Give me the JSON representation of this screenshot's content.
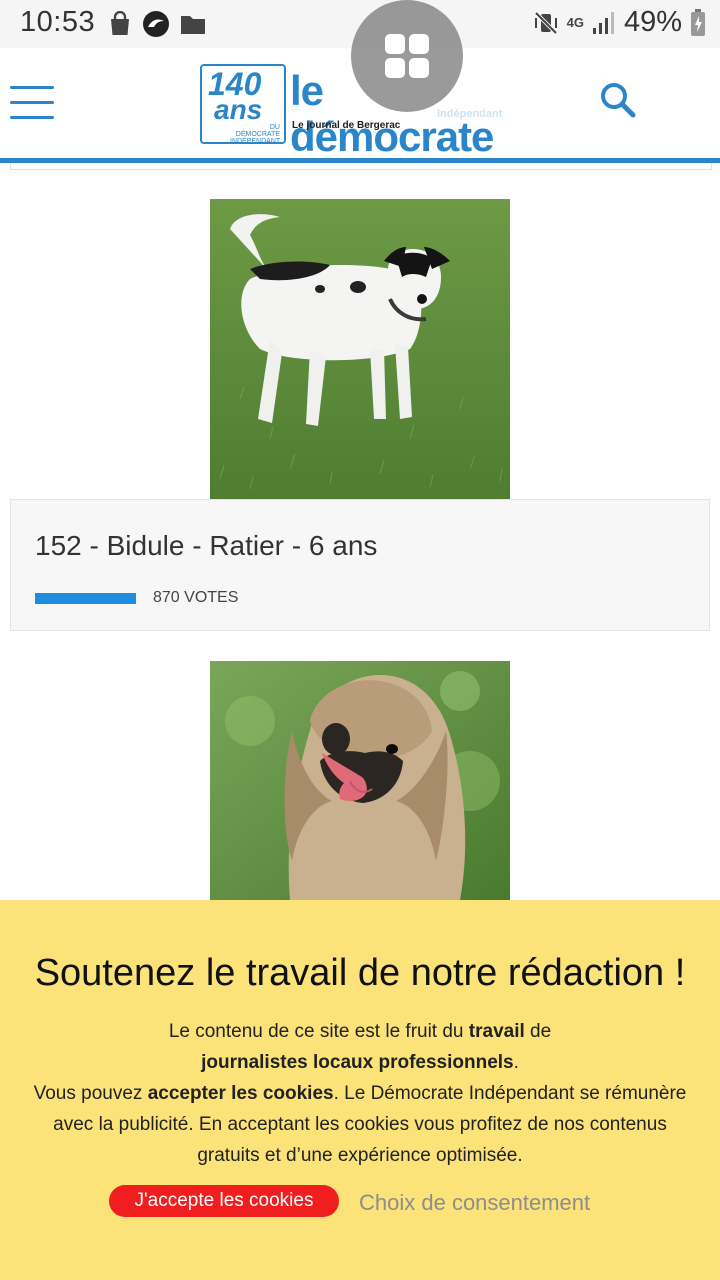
{
  "status_bar": {
    "time": "10:53",
    "battery_percent": "49%",
    "network_label": "4G",
    "icons": [
      "shopping-bag-icon",
      "app-notification-icon",
      "folder-icon",
      "vibrate-mute-icon",
      "signal-icon",
      "battery-icon"
    ]
  },
  "header": {
    "logo": {
      "anniversary_number": "140",
      "anniversary_word": "ans",
      "anniversary_small": "DU DÉMOCRATE INDÉPENDANT",
      "name": "le démocrate",
      "name_suffix": "Indépendant",
      "tagline": "Le journal de Bergerac"
    },
    "menu_icon": "hamburger-menu-icon",
    "search_icon": "search-icon",
    "accent_color": "#2a86c9"
  },
  "entries": [
    {
      "title": "152 - Bidule - Ratier - 6 ans",
      "votes_label": "870 VOTES",
      "votes": 870
    }
  ],
  "consent": {
    "title": "Soutenez le travail de notre rédaction !",
    "line1_a": "Le contenu de ce site est le fruit du ",
    "line1_b": "travail",
    "line1_c": " de",
    "line2_a": "journalistes locaux professionnels",
    "line2_b": ".",
    "line3_a": "Vous pouvez ",
    "line3_b": "accepter les cookies",
    "line3_c": ". Le Démocrate Indépendant se rémunère avec la publicité. En acceptant les cookies vous profitez de nos contenus gratuits et d’une expérience optimisée.",
    "accept_label": "J'accepte les cookies",
    "choice_label": "Choix de consentement",
    "background_color": "#fbe37a",
    "button_color": "#f01e1e"
  }
}
